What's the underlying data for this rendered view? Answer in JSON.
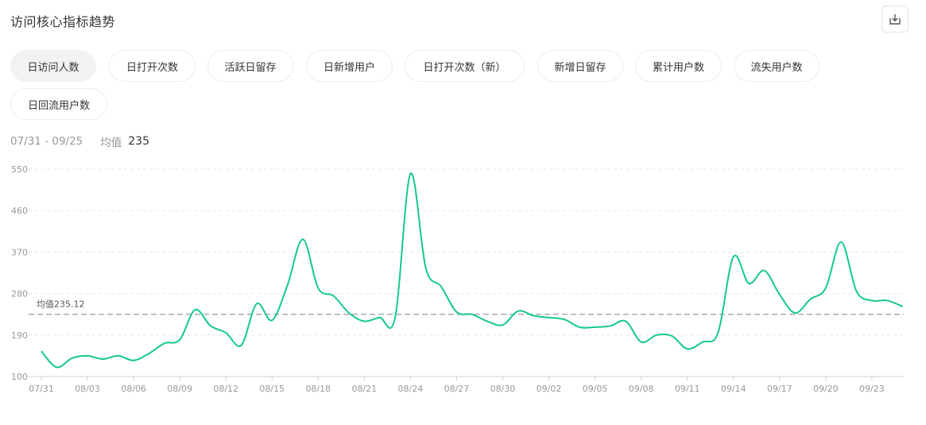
{
  "header": {
    "title": "访问核心指标趋势",
    "export_icon": "download-icon"
  },
  "tabs": [
    {
      "label": "日访问人数",
      "active": true
    },
    {
      "label": "日打开次数",
      "active": false
    },
    {
      "label": "活跃日留存",
      "active": false
    },
    {
      "label": "日新增用户",
      "active": false
    },
    {
      "label": "日打开次数（新）",
      "active": false
    },
    {
      "label": "新增日留存",
      "active": false
    },
    {
      "label": "累计用户数",
      "active": false
    },
    {
      "label": "流失用户数",
      "active": false
    },
    {
      "label": "日回流用户数",
      "active": false
    }
  ],
  "summary": {
    "date_range": "07/31 - 09/25",
    "avg_label": "均值",
    "avg_value": "235"
  },
  "colors": {
    "line": "#15c98a",
    "avg_line": "#aaaaaa",
    "grid": "#e6e6e6"
  },
  "chart_data": {
    "type": "line",
    "title": "",
    "xlabel": "",
    "ylabel": "",
    "ylim": [
      100,
      550
    ],
    "yticks": [
      100,
      190,
      280,
      370,
      460,
      550
    ],
    "grid": true,
    "x_tick_labels": [
      "07/31",
      "08/03",
      "08/06",
      "08/09",
      "08/12",
      "08/15",
      "08/18",
      "08/21",
      "08/24",
      "08/27",
      "08/30",
      "09/02",
      "09/05",
      "09/08",
      "09/11",
      "09/14",
      "09/17",
      "09/20",
      "09/23"
    ],
    "x": [
      "07/31",
      "08/01",
      "08/02",
      "08/03",
      "08/04",
      "08/05",
      "08/06",
      "08/07",
      "08/08",
      "08/09",
      "08/10",
      "08/11",
      "08/12",
      "08/13",
      "08/14",
      "08/15",
      "08/16",
      "08/17",
      "08/18",
      "08/19",
      "08/20",
      "08/21",
      "08/22",
      "08/23",
      "08/24",
      "08/25",
      "08/26",
      "08/27",
      "08/28",
      "08/29",
      "08/30",
      "08/31",
      "09/01",
      "09/02",
      "09/03",
      "09/04",
      "09/05",
      "09/06",
      "09/07",
      "09/08",
      "09/09",
      "09/10",
      "09/11",
      "09/12",
      "09/13",
      "09/14",
      "09/15",
      "09/16",
      "09/17",
      "09/18",
      "09/19",
      "09/20",
      "09/21",
      "09/22",
      "09/23",
      "09/24",
      "09/25"
    ],
    "values": [
      155,
      120,
      140,
      145,
      138,
      145,
      135,
      150,
      172,
      180,
      245,
      210,
      195,
      168,
      258,
      222,
      298,
      398,
      292,
      275,
      238,
      220,
      228,
      228,
      540,
      335,
      295,
      240,
      235,
      220,
      212,
      242,
      232,
      228,
      224,
      207,
      207,
      210,
      220,
      175,
      190,
      188,
      160,
      175,
      195,
      360,
      302,
      330,
      278,
      238,
      268,
      292,
      392,
      285,
      265,
      265,
      252
    ],
    "average": {
      "label": "均值235.12",
      "value": 235.12
    }
  }
}
